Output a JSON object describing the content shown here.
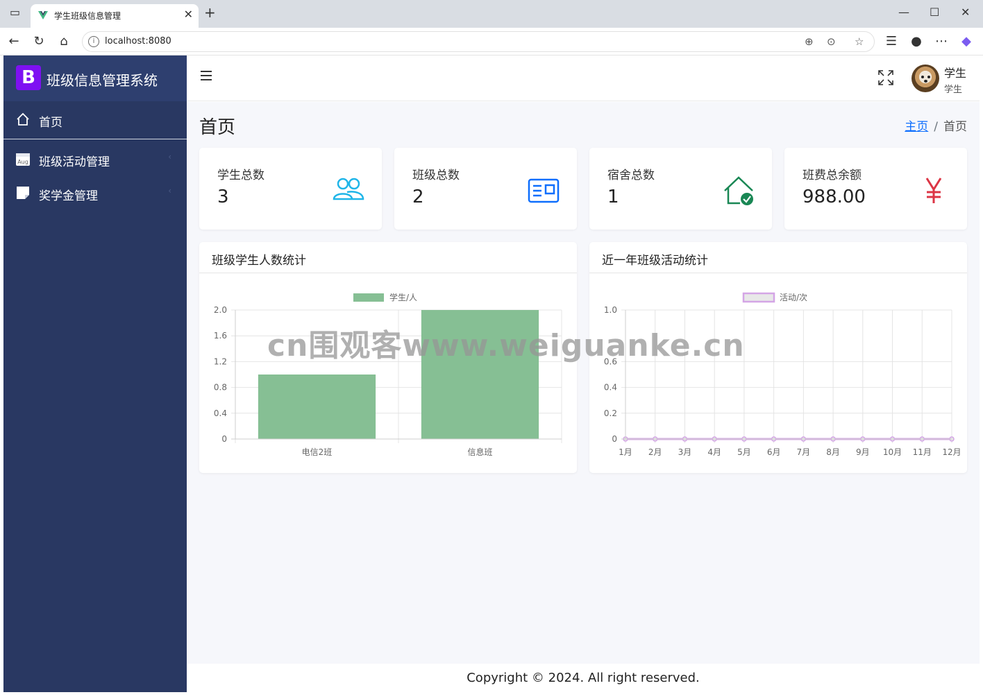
{
  "browser": {
    "tab_title": "学生班级信息管理",
    "url": "localhost:8080"
  },
  "sidebar": {
    "brand_letter": "B",
    "brand_name": "班级信息管理系统",
    "items": [
      {
        "label": "首页",
        "icon": "home-icon"
      },
      {
        "label": "班级活动管理",
        "icon": "calendar-icon",
        "icon_text": "Aug"
      },
      {
        "label": "奖学金管理",
        "icon": "sticky-note-icon"
      }
    ]
  },
  "header": {
    "user_name": "学生",
    "user_role": "学生"
  },
  "page": {
    "title": "首页",
    "breadcrumb": [
      {
        "label": "主页"
      },
      {
        "label": "首页"
      }
    ],
    "breadcrumb_sep": "/"
  },
  "stats": [
    {
      "label": "学生总数",
      "value": "3",
      "icon": "people-icon",
      "color": "#1fb5e8"
    },
    {
      "label": "班级总数",
      "value": "2",
      "icon": "id-card-icon",
      "color": "#0d6efd"
    },
    {
      "label": "宿舍总数",
      "value": "1",
      "icon": "house-check-icon",
      "color": "#198754"
    },
    {
      "label": "班费总余额",
      "value": "988.00",
      "icon": "yen-icon",
      "color": "#dc3545"
    }
  ],
  "charts": {
    "bar_title": "班级学生人数统计",
    "line_title": "近一年班级活动统计"
  },
  "chart_data": [
    {
      "type": "bar",
      "categories": [
        "电信2班",
        "信息班"
      ],
      "series": [
        {
          "name": "学生/人",
          "values": [
            1,
            2
          ],
          "color": "#86bf94"
        }
      ],
      "ylim": [
        0,
        2
      ],
      "yticks": [
        "0",
        "0.4",
        "0.8",
        "1.2",
        "1.6",
        "2.0"
      ],
      "grid": true,
      "legend": "top-center"
    },
    {
      "type": "line",
      "categories": [
        "1月",
        "2月",
        "3月",
        "4月",
        "5月",
        "6月",
        "7月",
        "8月",
        "9月",
        "10月",
        "11月",
        "12月"
      ],
      "series": [
        {
          "name": "活动/次",
          "values": [
            0,
            0,
            0,
            0,
            0,
            0,
            0,
            0,
            0,
            0,
            0,
            0
          ],
          "color": "#d4a5e6"
        }
      ],
      "ylim": [
        0,
        1
      ],
      "yticks": [
        "0",
        "0.2",
        "0.4",
        "0.6",
        "1.0"
      ],
      "grid": true,
      "legend": "top-center"
    }
  ],
  "footer": {
    "text": "Copyright © 2024. All right reserved."
  },
  "watermark": "cn围观客www.weiguanke.cn"
}
